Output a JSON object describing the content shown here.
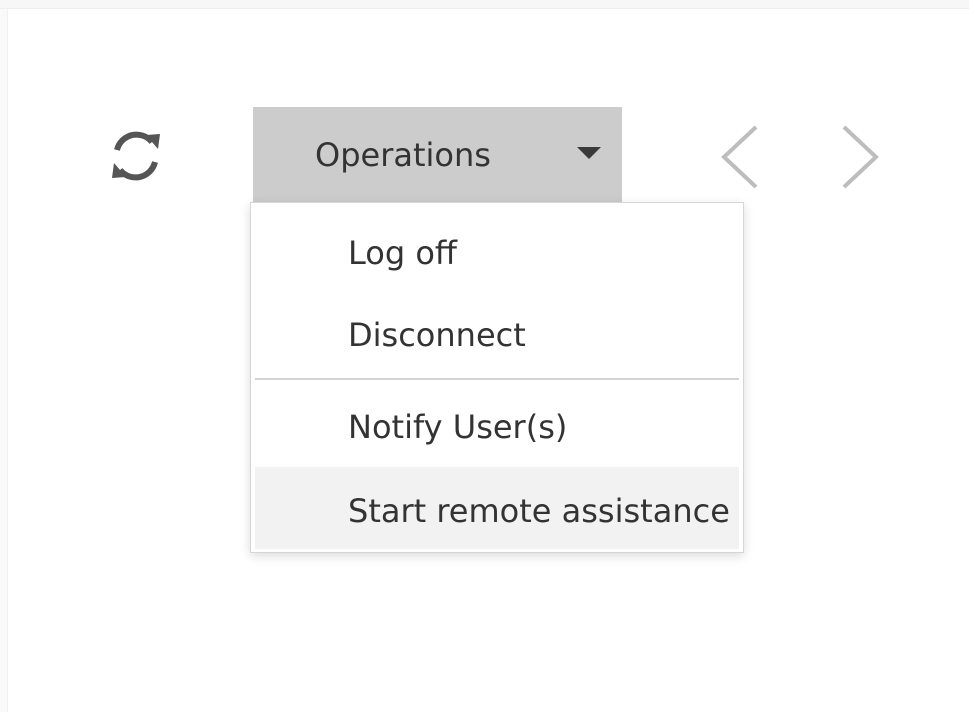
{
  "toolbar": {
    "refresh_icon": "refresh-icon",
    "operations_label": "Operations",
    "prev_icon": "chevron-left-icon",
    "next_icon": "chevron-right-icon"
  },
  "menu": {
    "items": [
      {
        "label": "Log off"
      },
      {
        "label": "Disconnect"
      },
      {
        "label": "Notify User(s)"
      },
      {
        "label": "Start remote assistance",
        "highlighted": true
      }
    ]
  },
  "colors": {
    "button_bg": "#cccccc",
    "text": "#333333",
    "icon": "#555555",
    "nav_icon": "#bdbdbd",
    "highlight_bg": "#f2f2f2"
  }
}
